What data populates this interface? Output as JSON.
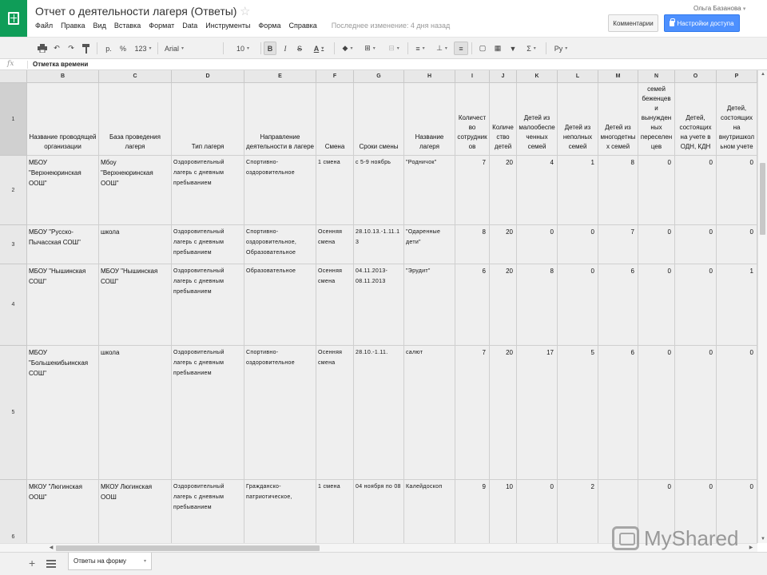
{
  "header": {
    "title": "Отчет о деятельности лагеря (Ответы)",
    "user": "Ольга Базанова",
    "comments_label": "Комментарии",
    "share_label": "Настройки доступа",
    "last_edit": "Последнее изменение: 4 дня назад"
  },
  "menu": [
    "Файл",
    "Правка",
    "Вид",
    "Вставка",
    "Формат",
    "Data",
    "Инструменты",
    "Форма",
    "Справка"
  ],
  "toolbar": {
    "currency": "р.",
    "percent": "%",
    "number_format": "123",
    "font": "Arial",
    "font_size": "10",
    "bold": "B",
    "italic": "I",
    "strike": "S",
    "text_color": "A",
    "sigma": "Σ",
    "language": "Ру"
  },
  "formula_bar": {
    "fx": "fx",
    "content": "Отметка времени"
  },
  "columns": [
    "B",
    "C",
    "D",
    "E",
    "F",
    "G",
    "H",
    "I",
    "J",
    "K",
    "L",
    "M",
    "N",
    "O",
    "P"
  ],
  "rows": [
    {
      "num": "1",
      "cells": [
        "Название проводящей организации",
        "База проведения лагеря",
        "Тип лагеря",
        "Направление деятельности в лагере",
        "Смена",
        "Сроки смены",
        "Название лагеря",
        "Количество сотрудников",
        "Количество детей",
        "Детей из малообеспеченных семей",
        "Детей из неполных семей",
        "Детей из многодетных семей",
        "Детей из семей беженцев и вынужденных переселенцев",
        "Детей, состоящих на учете в ОДН, КДН",
        "Детей, состоящих на внутришкольном учете"
      ]
    },
    {
      "num": "2",
      "cells": [
        "МБОУ \"Верхнеюринская ООШ\"",
        "Мбоу \"Верхнеюринская ООШ\"",
        "Оздоровительный лагерь с дневным пребыванием",
        "Спортивно-оздоровительное",
        "1 смена",
        "с 5-9 ноябрь",
        "\"Родничок\"",
        "7",
        "20",
        "4",
        "1",
        "8",
        "0",
        "0",
        "0"
      ]
    },
    {
      "num": "3",
      "cells": [
        "МБОУ \"Русско-Пычасская СОШ\"",
        "школа",
        "Оздоровительный лагерь с дневным пребыванием",
        "Спортивно-оздоровительное, Образовательное",
        "Осенняя смена",
        "28.10.13.-1.11.13",
        "\"Одаренные дети\"",
        "8",
        "20",
        "0",
        "0",
        "7",
        "0",
        "0",
        "0"
      ]
    },
    {
      "num": "4",
      "cells": [
        "МБОУ \"Нышинская СОШ\"",
        "МБОУ \"Нышинская СОШ\"",
        "Оздоровительный лагерь с дневным пребыванием",
        "Образовательное",
        "Осенняя смена",
        "04.11.2013-08.11.2013",
        "\"Эрудит\"",
        "6",
        "20",
        "8",
        "0",
        "6",
        "0",
        "0",
        "1"
      ]
    },
    {
      "num": "5",
      "cells": [
        "МБОУ \"Большекибьинская СОШ\"",
        "школа",
        "Оздоровительный лагерь с дневным пребыванием",
        "Спортивно-оздоровительное",
        "Осенняя смена",
        "28.10.-1.11.",
        "салют",
        "7",
        "20",
        "17",
        "5",
        "6",
        "0",
        "0",
        "0"
      ]
    },
    {
      "num": "6",
      "cells": [
        "МКОУ \"Люгинская ООШ\"",
        "МКОУ Люгинская ООШ",
        "Оздоровительный лагерь с дневным пребыванием",
        "Гражданско-патриотическое,",
        "1 смена",
        "04 ноября по 08",
        "Калейдоскоп",
        "9",
        "10",
        "0",
        "2",
        "",
        "0",
        "0",
        "0"
      ]
    }
  ],
  "sheet_tab": "Ответы на форму",
  "watermark": "MyShared",
  "colors": {
    "accent": "#4d90fe",
    "logo": "#0f9d58",
    "selected_bg": "#efefef"
  }
}
